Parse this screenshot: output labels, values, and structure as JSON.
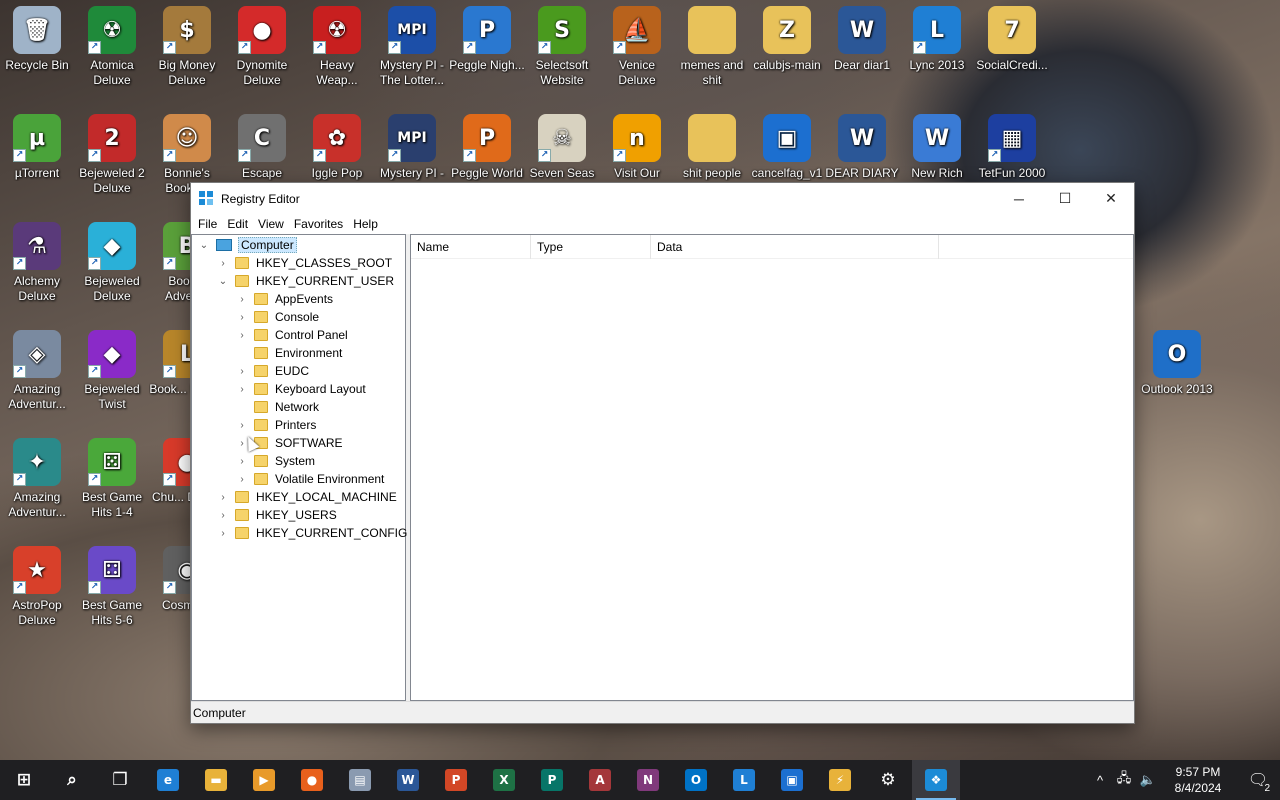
{
  "desktop": {
    "icons": [
      {
        "label": "Recycle Bin",
        "icon": "recycle-bin-icon",
        "glyph": "🗑",
        "color": "#9fb3c8",
        "shortcut": false
      },
      {
        "label": "Atomica Deluxe",
        "icon": "atomica-icon",
        "glyph": "☢",
        "color": "#1f8a3a",
        "shortcut": true
      },
      {
        "label": "Big Money Deluxe",
        "icon": "money-bag-icon",
        "glyph": "$",
        "color": "#a47a3c",
        "shortcut": true
      },
      {
        "label": "Dynomite Deluxe",
        "icon": "dynomite-egg-icon",
        "glyph": "●",
        "color": "#d42a2a",
        "shortcut": true
      },
      {
        "label": "Heavy Weap...",
        "icon": "radiation-icon",
        "glyph": "☢",
        "color": "#c81f1f",
        "shortcut": true
      },
      {
        "label": "Mystery PI - The Lotter...",
        "icon": "mystery-pi-icon",
        "glyph": "MPI",
        "color": "#1c4fa8",
        "shortcut": true
      },
      {
        "label": "Peggle Nigh...",
        "icon": "peggle-icon",
        "glyph": "P",
        "color": "#2a78d0",
        "shortcut": true
      },
      {
        "label": "Selectsoft Website",
        "icon": "selectsoft-icon",
        "glyph": "S",
        "color": "#4a9a1e",
        "shortcut": true
      },
      {
        "label": "Venice Deluxe",
        "icon": "venice-icon",
        "glyph": "⛵",
        "color": "#b8621c",
        "shortcut": true
      },
      {
        "label": "memes and shit",
        "icon": "folder-icon",
        "glyph": "",
        "color": "#e8c25a",
        "shortcut": false
      },
      {
        "label": "calubjs-main",
        "icon": "zip-folder-icon",
        "glyph": "Z",
        "color": "#e8c25a",
        "shortcut": false
      },
      {
        "label": "Dear diar1",
        "icon": "word-doc-icon",
        "glyph": "W",
        "color": "#2b5797",
        "shortcut": false
      },
      {
        "label": "Lync 2013",
        "icon": "lync-icon",
        "glyph": "L",
        "color": "#1f7fd4",
        "shortcut": true
      },
      {
        "label": "SocialCredi...",
        "icon": "7z-folder-icon",
        "glyph": "7",
        "color": "#e8c25a",
        "shortcut": false
      },
      {
        "label": "µTorrent",
        "icon": "utorrent-icon",
        "glyph": "µ",
        "color": "#4aa33a",
        "shortcut": true
      },
      {
        "label": "Bejeweled 2 Deluxe",
        "icon": "bejeweled2-icon",
        "glyph": "2",
        "color": "#c22a2a",
        "shortcut": true
      },
      {
        "label": "Bonnie's Books...",
        "icon": "bonnie-icon",
        "glyph": "☺",
        "color": "#d08a4a",
        "shortcut": true
      },
      {
        "label": "Escape",
        "icon": "escape-icon",
        "glyph": "C",
        "color": "#707070",
        "shortcut": true
      },
      {
        "label": "Iggle Pop",
        "icon": "iggle-pop-icon",
        "glyph": "✿",
        "color": "#c8302a",
        "shortcut": true
      },
      {
        "label": "Mystery PI -",
        "icon": "mystery-pi-2-icon",
        "glyph": "MPI",
        "color": "#2a3f6e",
        "shortcut": true
      },
      {
        "label": "Peggle World",
        "icon": "peggle-world-icon",
        "glyph": "P",
        "color": "#e06a1a",
        "shortcut": true
      },
      {
        "label": "Seven Seas",
        "icon": "skull-icon",
        "glyph": "☠",
        "color": "#d8d2c0",
        "shortcut": true
      },
      {
        "label": "Visit Our",
        "icon": "visit-our-icon",
        "glyph": "n",
        "color": "#f0a000",
        "shortcut": true
      },
      {
        "label": "shit people",
        "icon": "folder-image-icon",
        "glyph": "",
        "color": "#e8c25a",
        "shortcut": false
      },
      {
        "label": "cancelfag_v1",
        "icon": "image-file-icon",
        "glyph": "▣",
        "color": "#1c6fd0",
        "shortcut": false
      },
      {
        "label": "DEAR DIARY",
        "icon": "word-doc-2-icon",
        "glyph": "W",
        "color": "#2b5797",
        "shortcut": false
      },
      {
        "label": "New Rich",
        "icon": "wordpad-icon",
        "glyph": "W",
        "color": "#3a7bd5",
        "shortcut": false
      },
      {
        "label": "TetFun 2000",
        "icon": "tetfun-icon",
        "glyph": "▦",
        "color": "#1d3fa0",
        "shortcut": true
      },
      {
        "label": "Alchemy Deluxe",
        "icon": "alchemy-icon",
        "glyph": "⚗",
        "color": "#5a3a7a",
        "shortcut": true
      },
      {
        "label": "Bejeweled Deluxe",
        "icon": "diamond-icon",
        "glyph": "◆",
        "color": "#2ab0d8",
        "shortcut": true
      },
      {
        "label": "Book... Adven...",
        "icon": "bookworm-icon",
        "glyph": "B",
        "color": "#5aa03a",
        "shortcut": true
      },
      {
        "label": "Amazing Adventur...",
        "icon": "amazing-adventures-icon",
        "glyph": "◈",
        "color": "#7a8aa0",
        "shortcut": true
      },
      {
        "label": "Bejeweled Twist",
        "icon": "bejeweled-twist-icon",
        "glyph": "◆",
        "color": "#8a2ac8",
        "shortcut": true
      },
      {
        "label": "Book... Delu...",
        "icon": "bookworm-deluxe-icon",
        "glyph": "L",
        "color": "#b8862a",
        "shortcut": true
      },
      {
        "label": "Outlook 2013",
        "icon": "outlook-icon",
        "glyph": "O",
        "color": "#1f6fc8",
        "shortcut": false
      },
      {
        "label": "Amazing Adventur...",
        "icon": "amazing-adventures-2-icon",
        "glyph": "✦",
        "color": "#2a8a8a",
        "shortcut": true
      },
      {
        "label": "Best Game Hits 1-4",
        "icon": "dice-green-icon",
        "glyph": "⚄",
        "color": "#4aa83a",
        "shortcut": true
      },
      {
        "label": "Chu... Delu...",
        "icon": "chuzzle-icon",
        "glyph": "●",
        "color": "#d83a2a",
        "shortcut": true
      },
      {
        "label": "AstroPop Deluxe",
        "icon": "astropop-icon",
        "glyph": "★",
        "color": "#d8402a",
        "shortcut": true
      },
      {
        "label": "Best Game Hits 5-6",
        "icon": "dice-purple-icon",
        "glyph": "⚃",
        "color": "#6a4ac8",
        "shortcut": true
      },
      {
        "label": "Cosmic...",
        "icon": "cosmic-icon",
        "glyph": "◉",
        "color": "#606060",
        "shortcut": true
      }
    ]
  },
  "window": {
    "title": "Registry Editor",
    "controls": {
      "minimize": "─",
      "maximize": "☐",
      "close": "✕"
    },
    "menu": [
      "File",
      "Edit",
      "View",
      "Favorites",
      "Help"
    ],
    "tree": {
      "root": "Computer",
      "hives": [
        {
          "label": "HKEY_CLASSES_ROOT",
          "expander": "›"
        },
        {
          "label": "HKEY_CURRENT_USER",
          "expander": "⌄"
        },
        {
          "label": "HKEY_LOCAL_MACHINE",
          "expander": "›"
        },
        {
          "label": "HKEY_USERS",
          "expander": "›"
        },
        {
          "label": "HKEY_CURRENT_CONFIG",
          "expander": "›"
        }
      ],
      "current_user_children": [
        {
          "label": "AppEvents",
          "expander": "›"
        },
        {
          "label": "Console",
          "expander": "›"
        },
        {
          "label": "Control Panel",
          "expander": "›"
        },
        {
          "label": "Environment",
          "expander": ""
        },
        {
          "label": "EUDC",
          "expander": "›"
        },
        {
          "label": "Keyboard Layout",
          "expander": "›"
        },
        {
          "label": "Network",
          "expander": ""
        },
        {
          "label": "Printers",
          "expander": "›"
        },
        {
          "label": "SOFTWARE",
          "expander": "›"
        },
        {
          "label": "System",
          "expander": "›"
        },
        {
          "label": "Volatile Environment",
          "expander": "›"
        }
      ],
      "root_expander": "⌄"
    },
    "columns": [
      "Name",
      "Type",
      "Data"
    ],
    "status": "Computer"
  },
  "taskbar": {
    "items": [
      {
        "icon": "start-icon",
        "glyph": "⊞",
        "color": "transparent"
      },
      {
        "icon": "search-icon",
        "glyph": "⌕",
        "color": "transparent"
      },
      {
        "icon": "task-view-icon",
        "glyph": "❐",
        "color": "transparent"
      },
      {
        "icon": "edge-icon",
        "glyph": "e",
        "color": "#1f7fd4"
      },
      {
        "icon": "file-explorer-icon",
        "glyph": "▬",
        "color": "#e8b23a"
      },
      {
        "icon": "media-player-icon",
        "glyph": "▶",
        "color": "#e89a2a"
      },
      {
        "icon": "firefox-icon",
        "glyph": "●",
        "color": "#e8601c"
      },
      {
        "icon": "control-panel-icon",
        "glyph": "▤",
        "color": "#8a9ab0"
      },
      {
        "icon": "word-icon",
        "glyph": "W",
        "color": "#2b5797"
      },
      {
        "icon": "powerpoint-icon",
        "glyph": "P",
        "color": "#d24726"
      },
      {
        "icon": "excel-icon",
        "glyph": "X",
        "color": "#1e7145"
      },
      {
        "icon": "publisher-icon",
        "glyph": "P",
        "color": "#077568"
      },
      {
        "icon": "access-icon",
        "glyph": "A",
        "color": "#a4373a"
      },
      {
        "icon": "onenote-icon",
        "glyph": "N",
        "color": "#80397b"
      },
      {
        "icon": "outlook-taskbar-icon",
        "glyph": "O",
        "color": "#0072c6"
      },
      {
        "icon": "lync-taskbar-icon",
        "glyph": "L",
        "color": "#1f7fd4"
      },
      {
        "icon": "virtualbox-icon",
        "glyph": "▣",
        "color": "#1c6fd0"
      },
      {
        "icon": "network-tool-icon",
        "glyph": "⚡",
        "color": "#e8b23a"
      },
      {
        "icon": "settings-icon",
        "glyph": "⚙",
        "color": "transparent"
      },
      {
        "icon": "regedit-taskbar-icon",
        "glyph": "❖",
        "color": "#1c8bd6"
      }
    ],
    "tray": {
      "chevron": "^",
      "network": "🖧",
      "volume": "🔈",
      "time": "9:57 PM",
      "date": "8/4/2024",
      "notifications": "🗨",
      "notification_count": "2"
    }
  }
}
